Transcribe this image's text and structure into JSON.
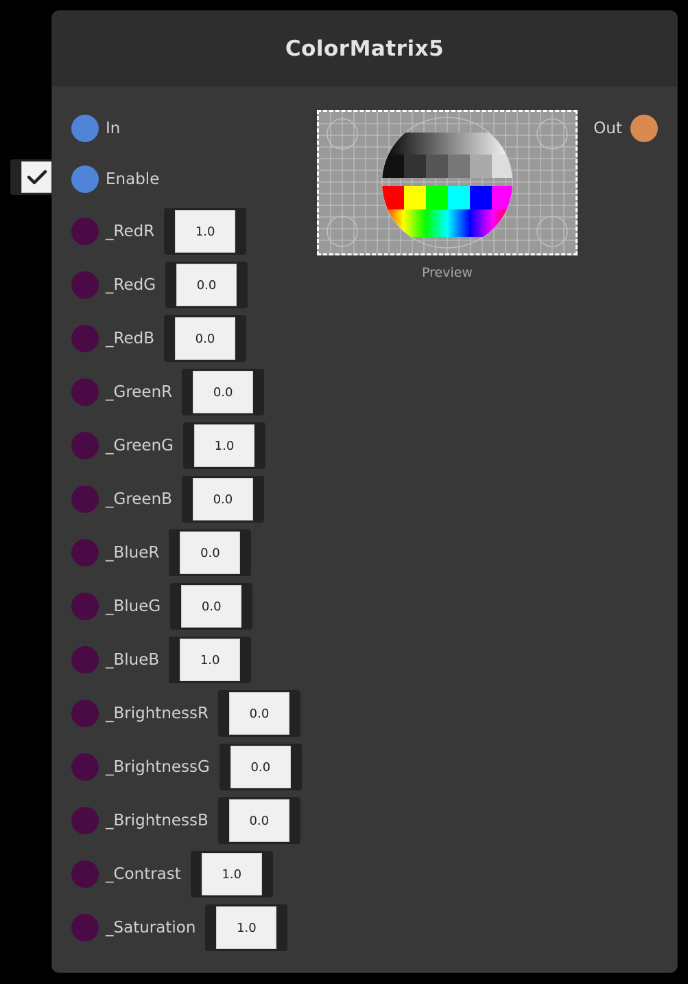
{
  "node": {
    "title": "ColorMatrix5",
    "inputs": {
      "in_label": "In",
      "enable_label": "Enable",
      "enable_checked": true
    },
    "output": {
      "label": "Out"
    },
    "preview_label": "Preview",
    "params": [
      {
        "label": "_RedR",
        "value": "1.0"
      },
      {
        "label": "_RedG",
        "value": "0.0"
      },
      {
        "label": "_RedB",
        "value": "0.0"
      },
      {
        "label": "_GreenR",
        "value": "0.0"
      },
      {
        "label": "_GreenG",
        "value": "1.0"
      },
      {
        "label": "_GreenB",
        "value": "0.0"
      },
      {
        "label": "_BlueR",
        "value": "0.0"
      },
      {
        "label": "_BlueG",
        "value": "0.0"
      },
      {
        "label": "_BlueB",
        "value": "1.0"
      },
      {
        "label": "_BrightnessR",
        "value": "0.0"
      },
      {
        "label": "_BrightnessG",
        "value": "0.0"
      },
      {
        "label": "_BrightnessB",
        "value": "0.0"
      },
      {
        "label": "_Contrast",
        "value": "1.0"
      },
      {
        "label": "_Saturation",
        "value": "1.0"
      }
    ],
    "colors": {
      "background": "#000000",
      "node_body": "#383838",
      "node_header": "#2e2e2e",
      "port_blue": "#4f84d8",
      "port_purple": "#4a0a45",
      "port_orange": "#d98a52"
    }
  }
}
